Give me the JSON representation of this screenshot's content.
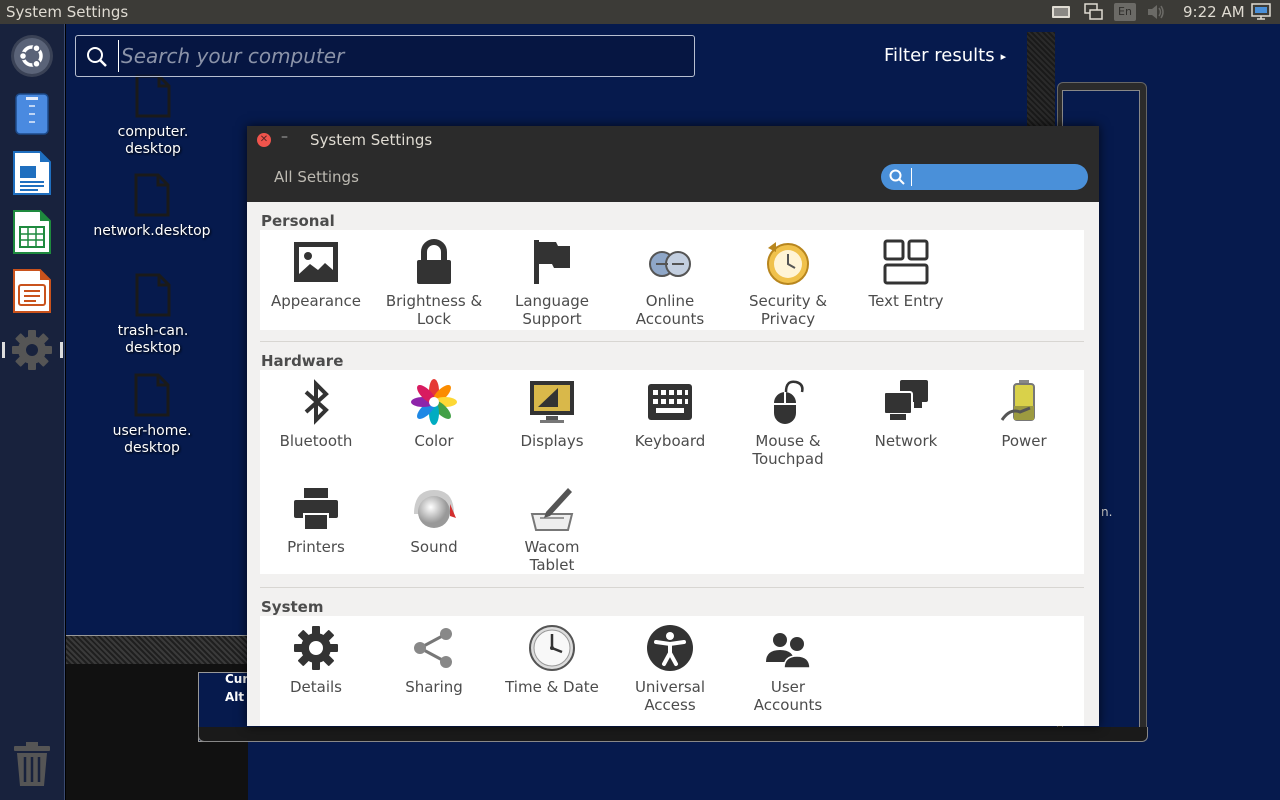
{
  "top_panel": {
    "title": "System Settings",
    "language": "En",
    "clock": "9:22 AM"
  },
  "launcher": {
    "items": [
      "ubuntu-dash-icon",
      "files-icon",
      "writer-icon",
      "calc-icon",
      "impress-icon",
      "system-settings-icon",
      "trash-icon"
    ]
  },
  "desktop": {
    "icons": [
      {
        "label": "computer.\ndesktop"
      },
      {
        "label": "network.desktop"
      },
      {
        "label": "trash-can.\ndesktop"
      },
      {
        "label": "user-home.\ndesktop"
      }
    ]
  },
  "dash": {
    "search_placeholder": "Search your computer",
    "filter_label": "Filter results"
  },
  "background": {
    "text_line1": "Cur",
    "text_line2": "Alt",
    "text_right": "n."
  },
  "settings": {
    "title": "System Settings",
    "all_settings": "All Settings",
    "search_value": "",
    "sections": {
      "personal": {
        "title": "Personal",
        "items": [
          "Appearance",
          "Brightness &\nLock",
          "Language\nSupport",
          "Online\nAccounts",
          "Security &\nPrivacy",
          "Text Entry"
        ]
      },
      "hardware": {
        "title": "Hardware",
        "items": [
          "Bluetooth",
          "Color",
          "Displays",
          "Keyboard",
          "Mouse &\nTouchpad",
          "Network",
          "Power",
          "Printers",
          "Sound",
          "Wacom\nTablet"
        ]
      },
      "system": {
        "title": "System",
        "items": [
          "Details",
          "Sharing",
          "Time & Date",
          "Universal\nAccess",
          "User\nAccounts"
        ]
      }
    }
  },
  "colors": {
    "desktop_bg": "#061a4d",
    "launcher_bg": "#18223d",
    "panel_bg": "#3c3b37",
    "accent_blue": "#4a90d9",
    "close_red": "#f0544c"
  }
}
